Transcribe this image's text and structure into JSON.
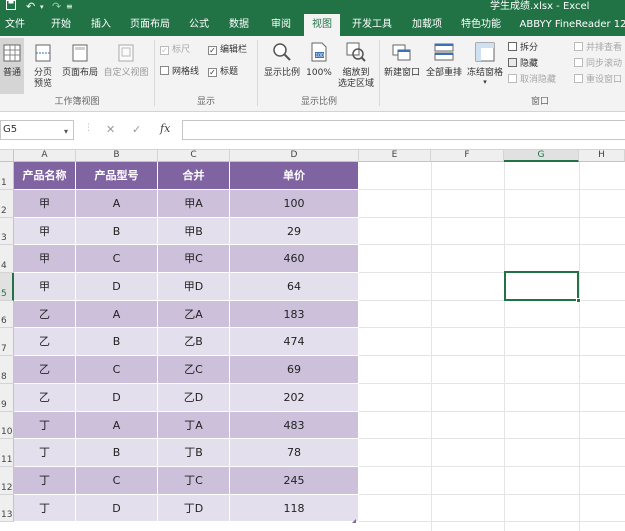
{
  "window": {
    "title": "学生成绩.xlsx - Excel"
  },
  "quick_access": {
    "save_icon": "save-icon",
    "undo_icon": "undo-icon",
    "redo_icon": "redo-icon",
    "customize_icon": "customize-icon"
  },
  "tabs": [
    {
      "label": "文件",
      "active": false
    },
    {
      "label": "开始",
      "active": false
    },
    {
      "label": "插入",
      "active": false
    },
    {
      "label": "页面布局",
      "active": false
    },
    {
      "label": "公式",
      "active": false
    },
    {
      "label": "数据",
      "active": false
    },
    {
      "label": "审阅",
      "active": false
    },
    {
      "label": "视图",
      "active": true
    },
    {
      "label": "开发工具",
      "active": false
    },
    {
      "label": "加载项",
      "active": false
    },
    {
      "label": "特色功能",
      "active": false
    },
    {
      "label": "ABBYY FineReader 12",
      "active": false
    }
  ],
  "ribbon": {
    "workbook_views": {
      "label": "工作簿视图",
      "normal": "普通",
      "page_break_1": "分页",
      "page_break_2": "预览",
      "page_layout": "页面布局",
      "custom_views": "自定义视图"
    },
    "show": {
      "label": "显示",
      "ruler": "标尺",
      "formula_bar": "编辑栏",
      "gridlines": "网格线",
      "headings": "标题",
      "ruler_checked": true,
      "formula_bar_checked": true,
      "gridlines_checked": false,
      "headings_checked": true
    },
    "zoom": {
      "label": "显示比例",
      "zoom": "显示比例",
      "zoom_100": "100%",
      "zoom_selection_1": "缩放到",
      "zoom_selection_2": "选定区域"
    },
    "window": {
      "label": "窗口",
      "new_window": "新建窗口",
      "arrange_all": "全部重排",
      "freeze_panes": "冻结窗格",
      "split": "拆分",
      "hide": "隐藏",
      "unhide": "取消隐藏",
      "view_side_by_side": "并排查看",
      "sync_scroll": "同步滚动",
      "reset_position": "重设窗口"
    }
  },
  "formula_bar": {
    "name_box": "G5",
    "cancel": "✕",
    "enter": "✓",
    "fx": "fx",
    "value": ""
  },
  "columns": [
    "A",
    "B",
    "C",
    "D",
    "E",
    "F",
    "G",
    "H"
  ],
  "rows": [
    "1",
    "2",
    "3",
    "4",
    "5",
    "6",
    "7",
    "8",
    "9",
    "10",
    "11",
    "12",
    "13"
  ],
  "selected_cell": {
    "column": "G",
    "row": "5"
  },
  "table": {
    "header_color": "#8064a2",
    "band_color_1": "#ccc0da",
    "band_color_2": "#e4dfec",
    "headers": [
      "产品名称",
      "产品型号",
      "合并",
      "单价"
    ],
    "rows": [
      [
        "甲",
        "A",
        "甲A",
        "100"
      ],
      [
        "甲",
        "B",
        "甲B",
        "29"
      ],
      [
        "甲",
        "C",
        "甲C",
        "460"
      ],
      [
        "甲",
        "D",
        "甲D",
        "64"
      ],
      [
        "乙",
        "A",
        "乙A",
        "183"
      ],
      [
        "乙",
        "B",
        "乙B",
        "474"
      ],
      [
        "乙",
        "C",
        "乙C",
        "69"
      ],
      [
        "乙",
        "D",
        "乙D",
        "202"
      ],
      [
        "丁",
        "A",
        "丁A",
        "483"
      ],
      [
        "丁",
        "B",
        "丁B",
        "78"
      ],
      [
        "丁",
        "C",
        "丁C",
        "245"
      ],
      [
        "丁",
        "D",
        "丁D",
        "118"
      ]
    ]
  }
}
